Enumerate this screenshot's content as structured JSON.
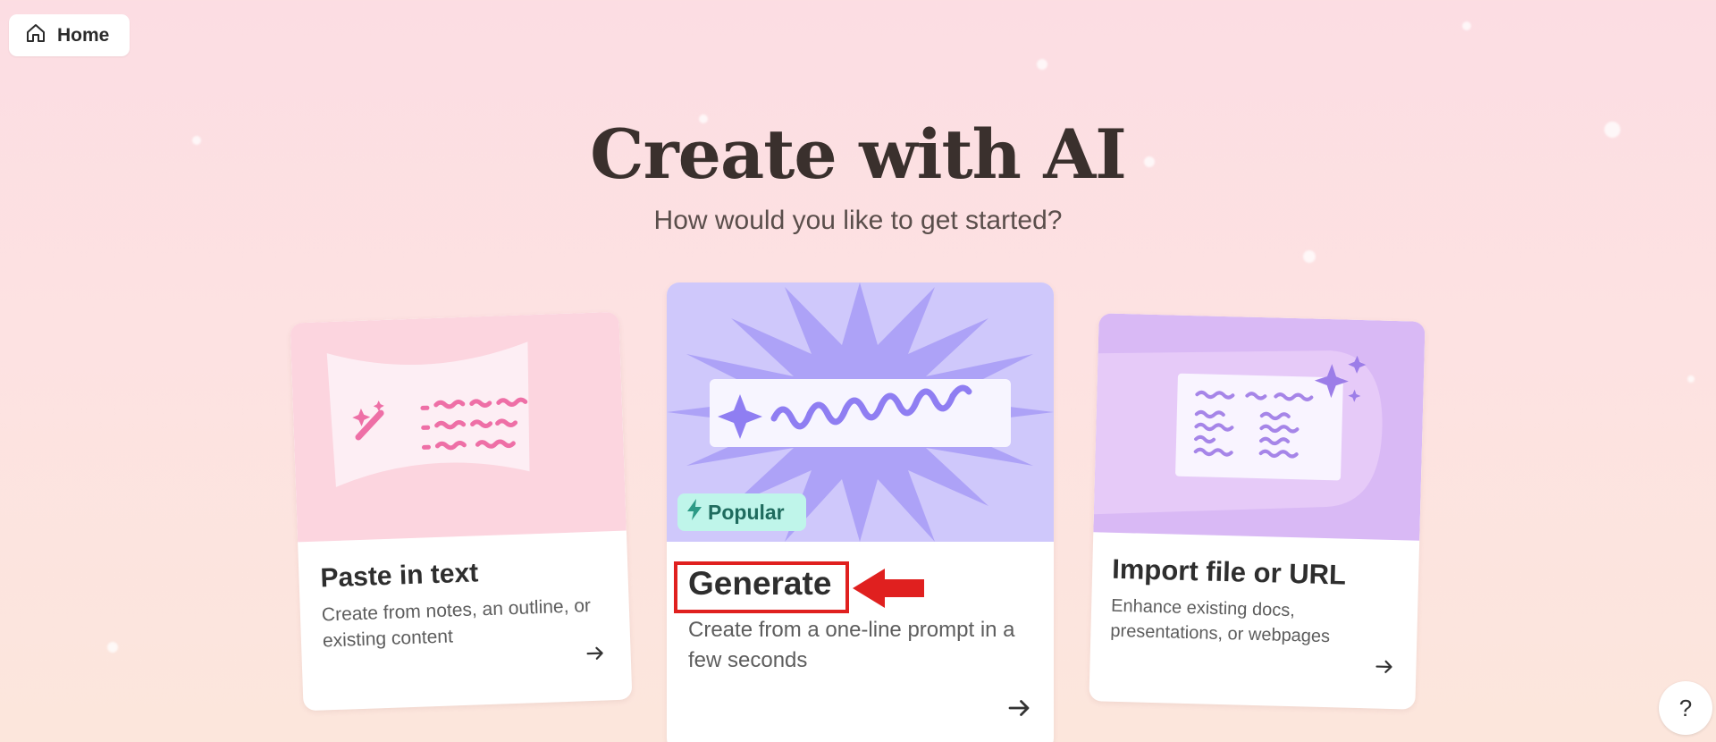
{
  "nav": {
    "home_label": "Home"
  },
  "header": {
    "title": "Create with AI",
    "subtitle": "How would you like to get started?"
  },
  "cards": [
    {
      "title": "Paste in text",
      "description": "Create from notes, an outline, or existing content",
      "icon": "wand-list-illustration"
    },
    {
      "title": "Generate",
      "description": "Create from a one-line prompt in a few seconds",
      "badge": "Popular",
      "icon": "starburst-prompt-illustration"
    },
    {
      "title": "Import file or URL",
      "description": "Enhance existing docs, presentations, or webpages",
      "icon": "document-import-illustration"
    }
  ],
  "help": {
    "label": "?"
  },
  "colors": {
    "accent_red": "#e0201f",
    "popular_badge": "#bff5ea",
    "generate_art": "#cfc8fb",
    "paste_art": "#fcd5df",
    "import_art": "#d9b9f5"
  }
}
